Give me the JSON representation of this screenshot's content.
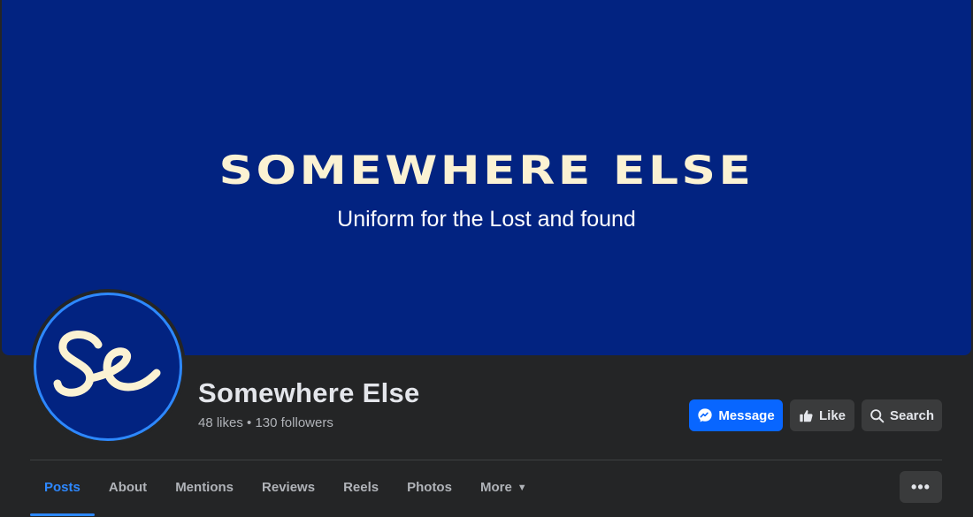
{
  "cover": {
    "title": "SOMEWHERE ELSE",
    "subtitle": "Uniform for the Lost and found",
    "background_color": "#022381",
    "text_color": "#fbf2d3"
  },
  "profile": {
    "avatar_logo_text": "Se",
    "name": "Somewhere Else",
    "stats": "48 likes • 130 followers"
  },
  "actions": {
    "message_label": "Message",
    "message_icon": "messenger-icon",
    "like_label": "Like",
    "like_icon": "thumbs-up-icon",
    "search_label": "Search",
    "search_icon": "search-icon"
  },
  "tabs": [
    {
      "label": "Posts",
      "active": true
    },
    {
      "label": "About"
    },
    {
      "label": "Mentions"
    },
    {
      "label": "Reviews"
    },
    {
      "label": "Reels"
    },
    {
      "label": "Photos"
    },
    {
      "label": "More",
      "icon": "caret-down-icon",
      "caret": "▼"
    }
  ],
  "overflow_menu": {
    "label": "•••",
    "icon": "more-horizontal-icon"
  },
  "colors": {
    "accent": "#2d88ff",
    "primary_button": "#0866ff",
    "surface": "#242526",
    "secondary_button": "#3a3b3c"
  }
}
